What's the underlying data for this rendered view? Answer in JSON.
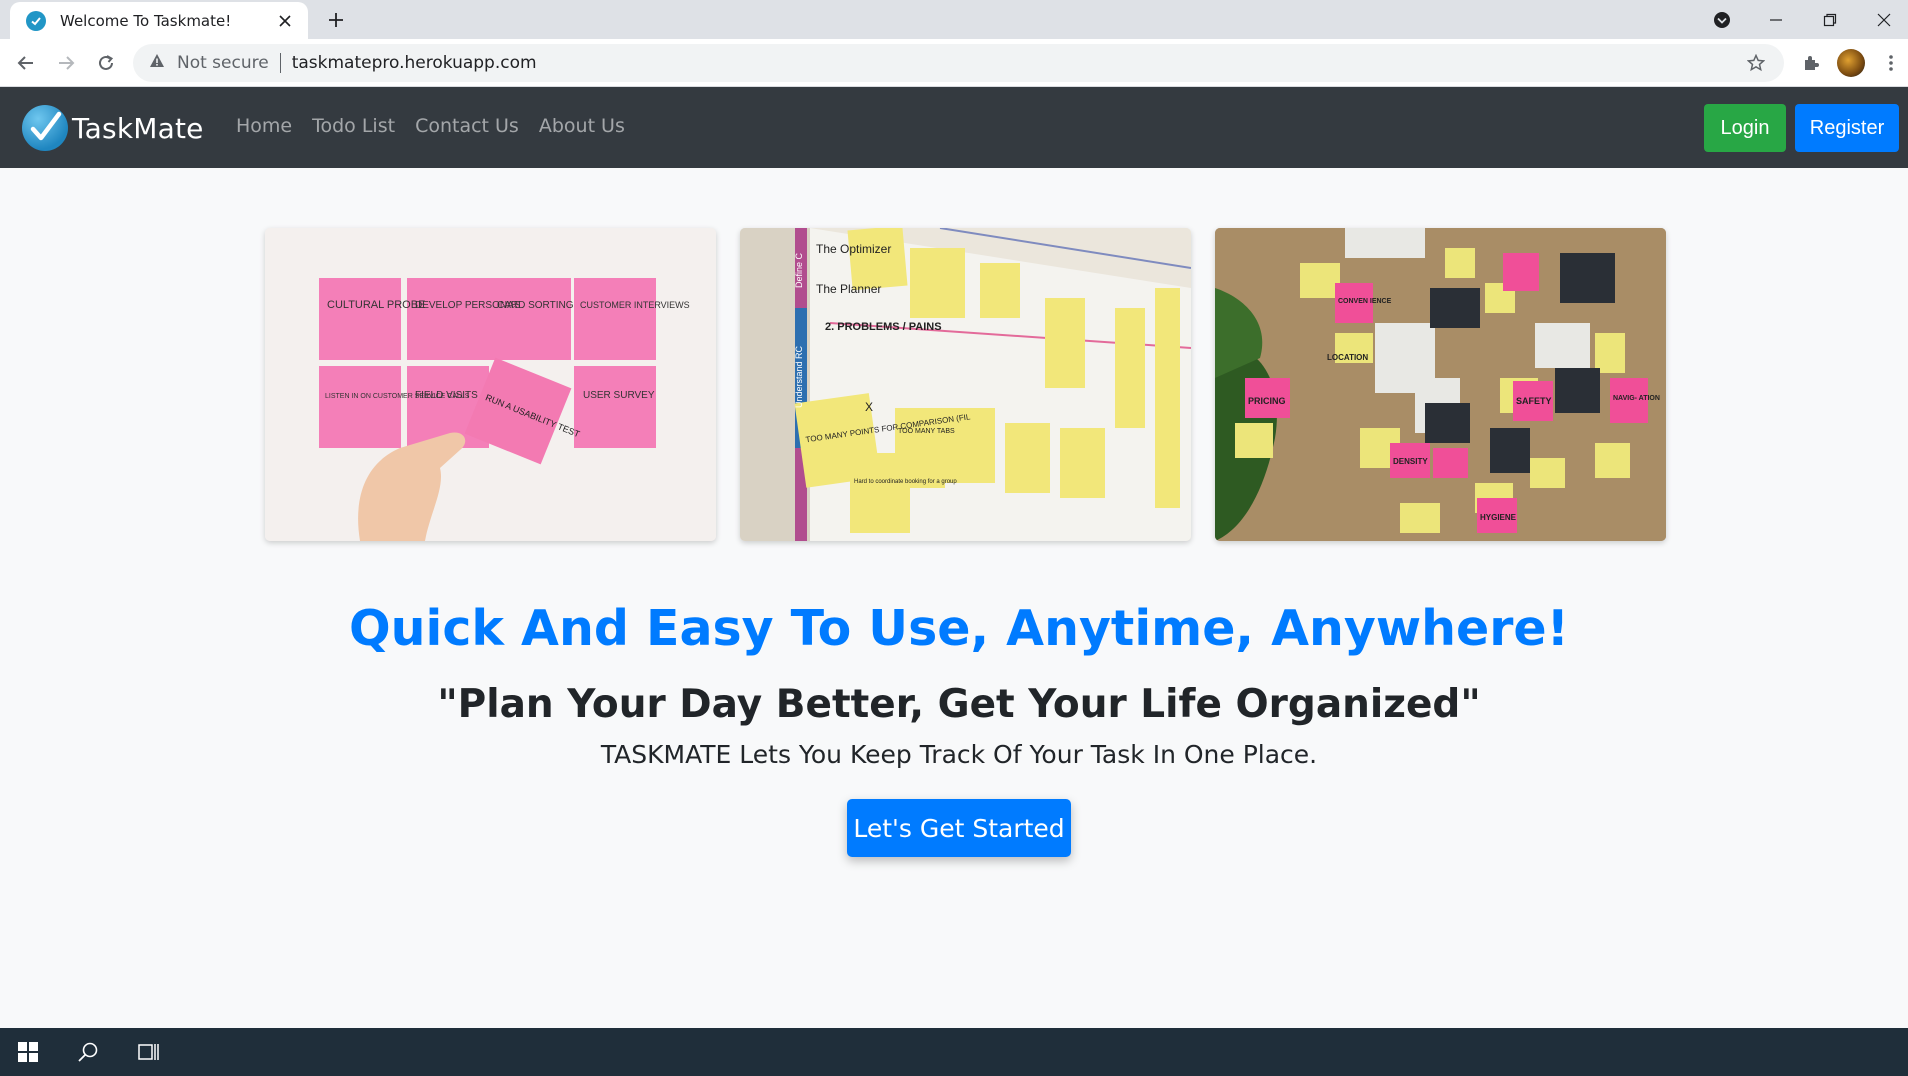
{
  "browser": {
    "tab_title": "Welcome To Taskmate!",
    "url_security": "Not secure",
    "url": "taskmatepro.herokuapp.com",
    "icons": [
      "favicon-check-icon",
      "close-icon",
      "plus-icon",
      "tab-search-icon",
      "minimize-icon",
      "restore-icon",
      "window-close-icon",
      "back-arrow-icon",
      "forward-arrow-icon",
      "reload-icon",
      "warning-icon",
      "star-icon",
      "puzzle-icon",
      "avatar",
      "kebab-menu-icon"
    ]
  },
  "navbar": {
    "brand": "TaskMate",
    "links": [
      "Home",
      "Todo List",
      "Contact Us",
      "About Us"
    ],
    "login": "Login",
    "register": "Register",
    "colors": {
      "bg": "#343a40",
      "login": "#28a745",
      "register": "#007bff"
    }
  },
  "images": {
    "first": {
      "notes": [
        "CULTURAL PROBE",
        "DEVELOP PERSONAS",
        "CARD SORTING",
        "CUSTOMER INTERVIEWS",
        "LISTEN IN ON CUSTOMER SERVICE CALLS",
        "FIELD VISITS",
        "USER SURVEY",
        "RUN A USABILITY TEST"
      ]
    },
    "second": {
      "board_texts": [
        "The Optimizer",
        "The Planner",
        "Define C",
        "2. PROBLEMS / PAINS",
        "Understand RC",
        "TOO MANY POINTS FOR COMPARISON (FIL",
        "X",
        "Hard to coordinate booking for a group",
        "TOO MANY TABS"
      ]
    },
    "third": {
      "notes": [
        "PRICING",
        "LOCATION",
        "CONVEN IENCE",
        "SAFETY",
        "NAVIG- ATION",
        "DENSITY",
        "HYGIENE"
      ]
    }
  },
  "hero": {
    "title": "Quick And Easy To Use, Anytime, Anywhere!",
    "quote": "\"Plan Your Day Better, Get Your Life Organized\"",
    "subtitle": "TASKMATE Lets You Keep Track Of Your Task In One Place.",
    "cta": "Let's Get Started",
    "accent": "#007bff"
  },
  "taskbar": {
    "icons": [
      "windows-start-icon",
      "search-icon",
      "task-view-icon"
    ]
  }
}
